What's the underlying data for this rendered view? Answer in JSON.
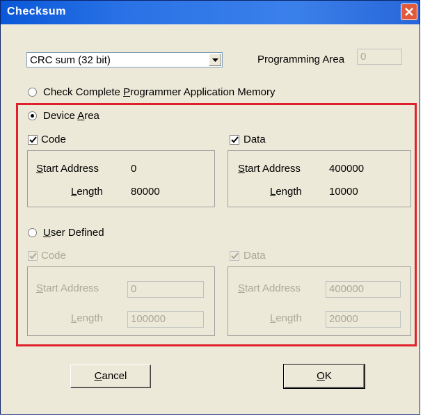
{
  "window": {
    "title": "Checksum"
  },
  "combo": {
    "value": "CRC sum (32 bit)"
  },
  "programming_area": {
    "label": "Programming Area",
    "value": "0"
  },
  "options": {
    "complete": "Check Complete Programmer Application Memory",
    "device_area": "Device Area",
    "user_defined": "User Defined"
  },
  "device": {
    "code": {
      "label": "Code",
      "start_label": "Start Address",
      "start": "0",
      "length_label": "Length",
      "length": "80000"
    },
    "data": {
      "label": "Data",
      "start_label": "Start Address",
      "start": "400000",
      "length_label": "Length",
      "length": "10000"
    }
  },
  "user": {
    "code": {
      "label": "Code",
      "start_label": "Start Address",
      "start": "0",
      "length_label": "Length",
      "length": "100000"
    },
    "data": {
      "label": "Data",
      "start_label": "Start Address",
      "start": "400000",
      "length_label": "Length",
      "length": "20000"
    }
  },
  "buttons": {
    "cancel": "Cancel",
    "ok": "OK"
  },
  "colors": {
    "titlebar": "#0a58d8",
    "highlight": "#e0202a",
    "face": "#ece9d8"
  },
  "icons": [
    "close-icon",
    "dropdown-arrow-icon",
    "checkmark-icon"
  ]
}
